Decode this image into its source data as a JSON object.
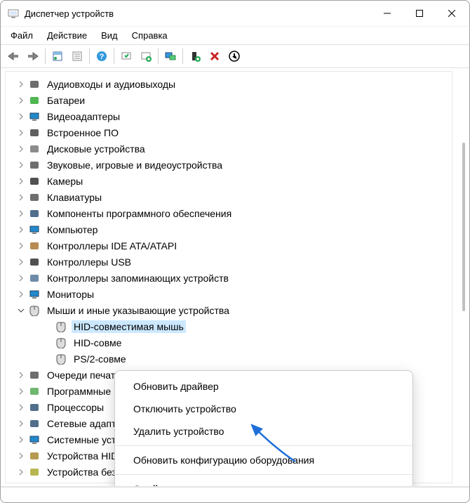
{
  "window": {
    "title": "Диспетчер устройств"
  },
  "menubar": {
    "file": "Файл",
    "action": "Действие",
    "view": "Вид",
    "help": "Справка"
  },
  "toolbar": {
    "back": "back",
    "forward": "forward",
    "show_hidden": "show-hidden",
    "view_mode": "view-mode",
    "help": "help",
    "scan": "scan-hardware",
    "add_legacy": "add-legacy",
    "remote": "remote",
    "update_driver": "update-driver",
    "uninstall": "uninstall",
    "properties": "properties"
  },
  "tree": {
    "items": [
      {
        "label": "Аудиовходы и аудиовыходы",
        "icon": "speaker-icon"
      },
      {
        "label": "Батареи",
        "icon": "battery-icon"
      },
      {
        "label": "Видеоадаптеры",
        "icon": "display-adapter-icon"
      },
      {
        "label": "Встроенное ПО",
        "icon": "firmware-icon"
      },
      {
        "label": "Дисковые устройства",
        "icon": "disk-icon"
      },
      {
        "label": "Звуковые, игровые и видеоустройства",
        "icon": "sound-icon"
      },
      {
        "label": "Камеры",
        "icon": "camera-icon"
      },
      {
        "label": "Клавиатуры",
        "icon": "keyboard-icon"
      },
      {
        "label": "Компоненты программного обеспечения",
        "icon": "software-icon"
      },
      {
        "label": "Компьютер",
        "icon": "computer-icon"
      },
      {
        "label": "Контроллеры IDE ATA/ATAPI",
        "icon": "ide-icon"
      },
      {
        "label": "Контроллеры USB",
        "icon": "usb-icon"
      },
      {
        "label": "Контроллеры запоминающих устройств",
        "icon": "storage-icon"
      },
      {
        "label": "Мониторы",
        "icon": "monitor-icon"
      },
      {
        "label": "Мыши и иные указывающие устройства",
        "icon": "mouse-icon",
        "expanded": true,
        "children": [
          {
            "label": "HID-совместимая мышь",
            "selected": true
          },
          {
            "label": "HID-совме"
          },
          {
            "label": "PS/2-совме"
          }
        ]
      },
      {
        "label": "Очереди печат",
        "icon": "printer-icon"
      },
      {
        "label": "Программные",
        "icon": "software2-icon"
      },
      {
        "label": "Процессоры",
        "icon": "cpu-icon"
      },
      {
        "label": "Сетевые адапт",
        "icon": "network-icon"
      },
      {
        "label": "Системные уст",
        "icon": "system-icon"
      },
      {
        "label": "Устройства HID (Human Interface Devices)",
        "icon": "hid-icon"
      },
      {
        "label": "Устройства безопасности",
        "icon": "security-icon"
      }
    ]
  },
  "ctx": {
    "update_driver": "Обновить драйвер",
    "disable": "Отключить устройство",
    "uninstall": "Удалить устройство",
    "scan": "Обновить конфигурацию оборудования",
    "properties": "Свойства"
  }
}
